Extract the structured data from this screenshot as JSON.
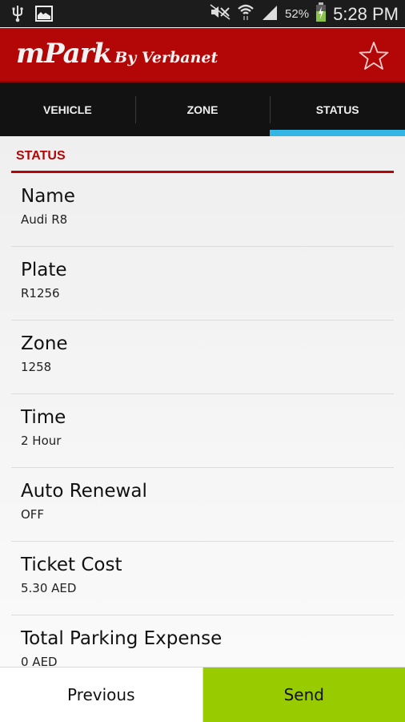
{
  "status_bar": {
    "left_icons": [
      "usb-icon",
      "image-icon"
    ],
    "right_icons": [
      "mute-icon",
      "wifi-icon",
      "signal-icon",
      "battery-charging-icon"
    ],
    "battery": "52%",
    "time": "5:28 PM"
  },
  "app_bar": {
    "title_main": "mPark",
    "title_sub": "By Verbanet",
    "action_icon": "star-icon"
  },
  "tabs": [
    {
      "label": "VEHICLE",
      "active": false
    },
    {
      "label": "ZONE",
      "active": false
    },
    {
      "label": "STATUS",
      "active": true
    }
  ],
  "section": {
    "title": "STATUS"
  },
  "fields": [
    {
      "label": "Name",
      "value": "Audi R8"
    },
    {
      "label": "Plate",
      "value": "R1256"
    },
    {
      "label": "Zone",
      "value": "1258"
    },
    {
      "label": "Time",
      "value": "2 Hour"
    },
    {
      "label": "Auto Renewal",
      "value": "OFF"
    },
    {
      "label": "Ticket Cost",
      "value": "5.30 AED"
    },
    {
      "label": "Total Parking Expense",
      "value": "0 AED"
    }
  ],
  "buttons": {
    "previous": "Previous",
    "send": "Send"
  },
  "colors": {
    "primary": "#b30707",
    "tab_indicator": "#33b5e5",
    "send": "#99cc00"
  }
}
